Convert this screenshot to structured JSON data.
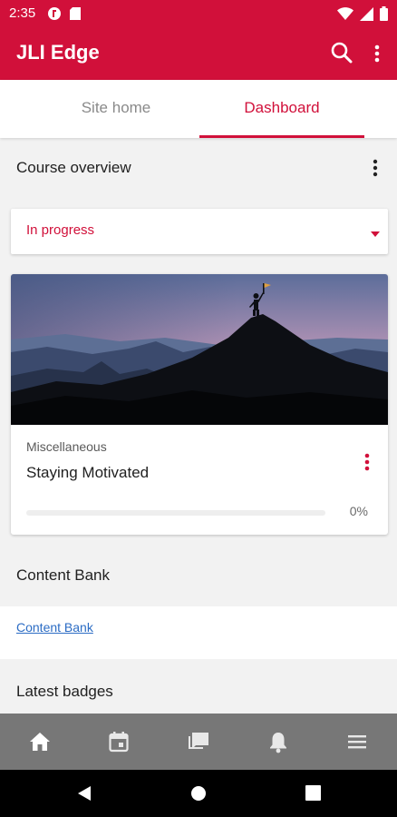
{
  "status_bar": {
    "time": "2:35"
  },
  "app_bar": {
    "title": "JLI Edge",
    "icons": [
      "search-icon",
      "more-vert-icon"
    ]
  },
  "tabs": [
    {
      "label": "Site home",
      "active": false
    },
    {
      "label": "Dashboard",
      "active": true
    }
  ],
  "course_overview": {
    "title": "Course overview",
    "filter": {
      "selected": "In progress"
    },
    "courses": [
      {
        "category": "Miscellaneous",
        "name": "Staying Motivated",
        "progress": 0,
        "progress_label": "0%"
      }
    ]
  },
  "content_bank": {
    "title": "Content Bank",
    "link": "Content Bank"
  },
  "latest_badges": {
    "title": "Latest badges"
  },
  "bottom_nav": [
    {
      "icon": "home-icon",
      "active": true
    },
    {
      "icon": "calendar-icon",
      "active": false
    },
    {
      "icon": "messages-icon",
      "active": false
    },
    {
      "icon": "bell-icon",
      "active": false
    },
    {
      "icon": "menu-icon",
      "active": false
    }
  ],
  "colors": {
    "primary": "#d1103a",
    "link": "#2b6cc4",
    "bottom_nav": "#777777"
  }
}
